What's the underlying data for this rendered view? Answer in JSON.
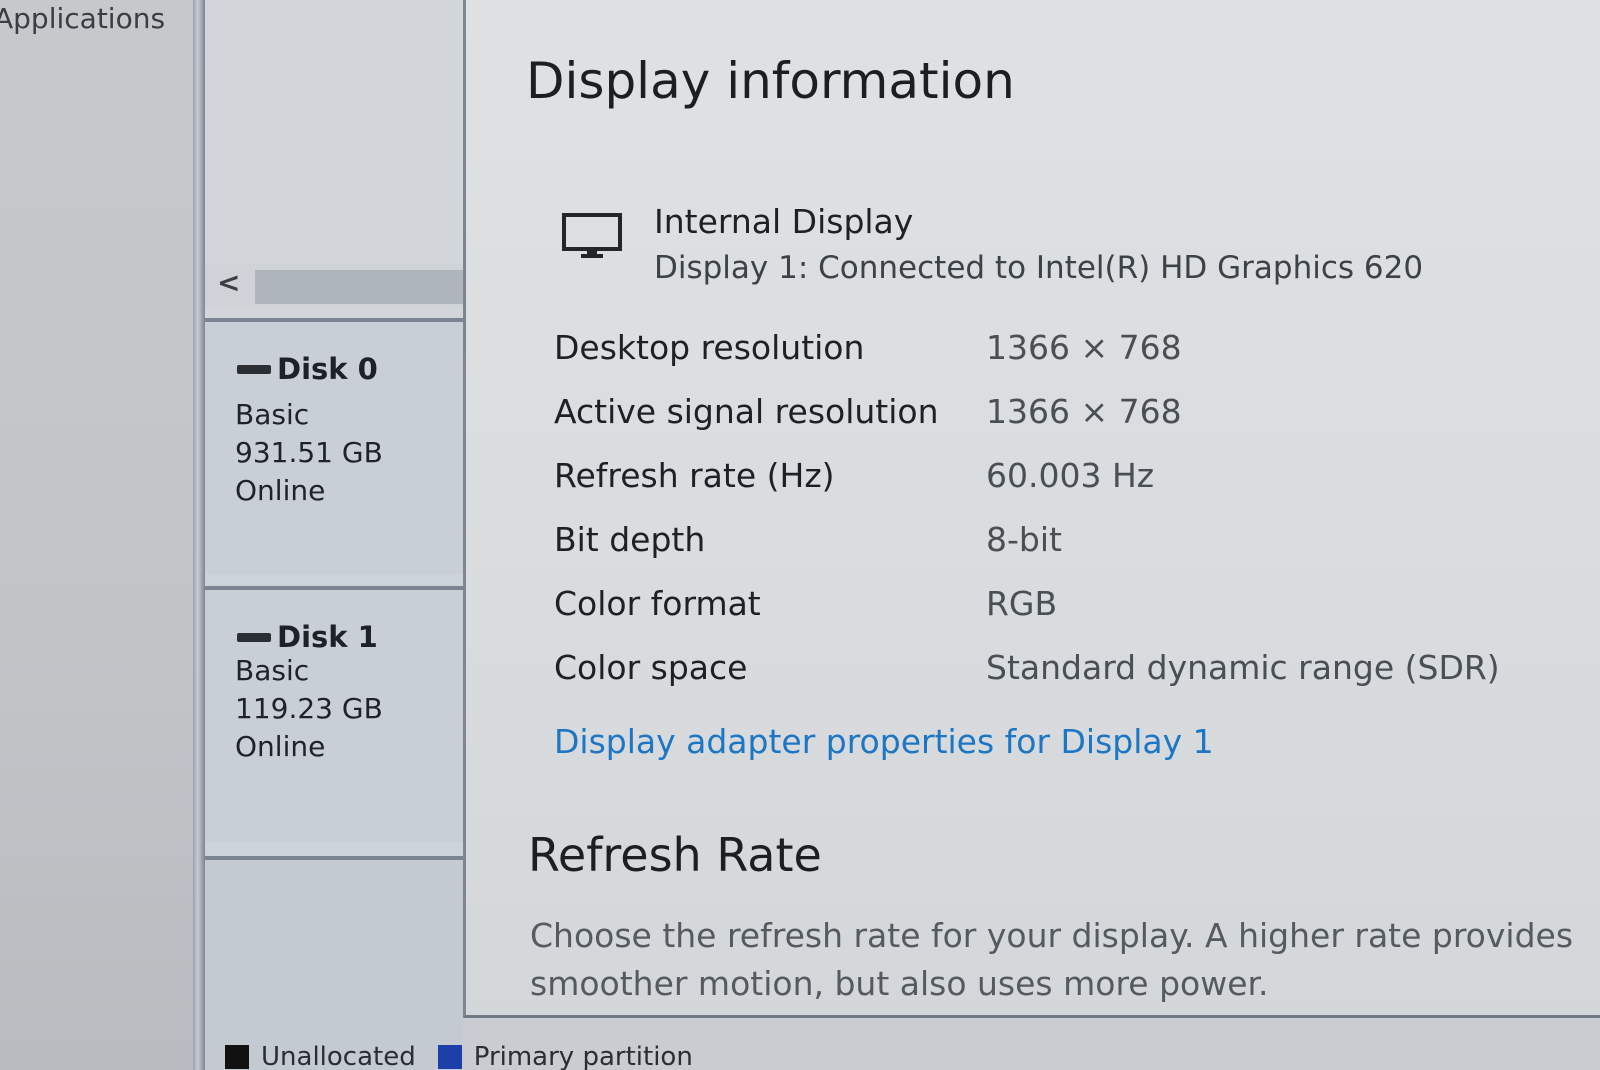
{
  "background_app": {
    "applications_label": "Applications"
  },
  "disk_management": {
    "scroll_left_glyph": "<",
    "disks": [
      {
        "name": "Disk 0",
        "type": "Basic",
        "size": "931.51 GB",
        "status": "Online"
      },
      {
        "name": "Disk 1",
        "type": "Basic",
        "size": "119.23 GB",
        "status": "Online"
      }
    ],
    "legend": [
      {
        "label": "Unallocated",
        "color": "#111111"
      },
      {
        "label": "Primary partition",
        "color": "#1c3fa8"
      }
    ]
  },
  "display_info": {
    "title": "Display information",
    "display_name": "Internal Display",
    "display_subtitle": "Display 1: Connected to Intel(R) HD Graphics 620",
    "rows": [
      {
        "label": "Desktop resolution",
        "value": "1366 × 768"
      },
      {
        "label": "Active signal resolution",
        "value": "1366 × 768"
      },
      {
        "label": "Refresh rate (Hz)",
        "value": "60.003 Hz"
      },
      {
        "label": "Bit depth",
        "value": "8-bit"
      },
      {
        "label": "Color format",
        "value": "RGB"
      },
      {
        "label": "Color space",
        "value": "Standard dynamic range (SDR)"
      }
    ],
    "adapter_link": "Display adapter properties for Display 1",
    "link_color": "#1d76c4"
  },
  "refresh_rate": {
    "title": "Refresh Rate",
    "description": "Choose the refresh rate for your display. A higher rate provides smoother motion, but also uses more power."
  }
}
